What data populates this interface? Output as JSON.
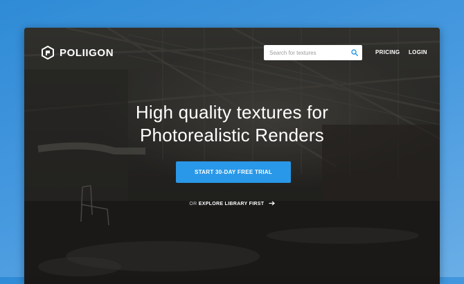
{
  "brand": {
    "name": "POLIIGON"
  },
  "search": {
    "placeholder": "Search for textures"
  },
  "nav": {
    "pricing": "PRICING",
    "login": "LOGIN"
  },
  "hero": {
    "headline_line1": "High quality textures for",
    "headline_line2": "Photorealistic Renders",
    "cta_label": "START 30-DAY FREE TRIAL",
    "explore_prefix": "OR",
    "explore_link": "EXPLORE LIBRARY FIRST"
  },
  "colors": {
    "page_background": "#3d95de",
    "cta_background": "#2a98e8",
    "search_icon": "#2a98e8",
    "text": "#ffffff"
  },
  "icons": {
    "logo": "poliigon-hexagon-icon",
    "search": "search-icon",
    "explore_arrow": "arrow-right-icon"
  }
}
